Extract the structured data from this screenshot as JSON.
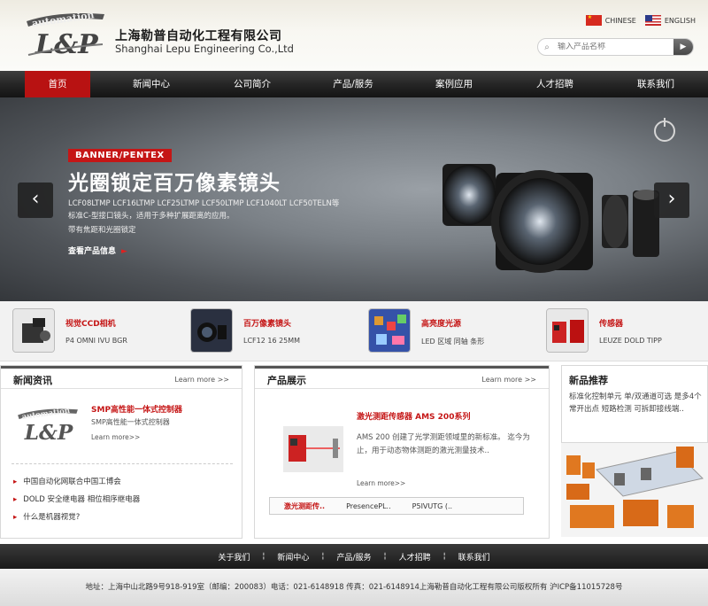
{
  "header": {
    "logo_text": "automation L&P",
    "company_cn": "上海勒普自动化工程有限公司",
    "company_en": "Shanghai Lepu Engineering Co.,Ltd",
    "lang": {
      "chinese": "CHINESE",
      "english": "ENGLISH"
    },
    "search": {
      "placeholder": "输入产品名称"
    }
  },
  "nav": {
    "items": [
      "首页",
      "新闻中心",
      "公司简介",
      "产品/服务",
      "案例应用",
      "人才招聘",
      "联系我们"
    ],
    "active_color": "#b81212"
  },
  "banner": {
    "brand": "BANNER/PENTEX",
    "title": "光圈锁定百万像素镜头",
    "models": "LCF08LTMP LCF16LTMP LCF25LTMP LCF50LTMP LCF1040LT LCF50TELN等",
    "desc1": "标准C-型接口镜头，适用于多种扩展距离的应用。",
    "desc2": "带有焦距和光圈锁定",
    "more": "查看产品信息"
  },
  "product_strip": [
    {
      "title": "视觉CCD相机",
      "desc": "P4 OMNI IVU BGR"
    },
    {
      "title": "百万像素镜头",
      "desc": "LCF12 16 25MM"
    },
    {
      "title": "高亮度光源",
      "desc": "LED 区域 同轴 条形"
    },
    {
      "title": "传感器",
      "desc": "LEUZE DOLD TIPP"
    }
  ],
  "news": {
    "title": "新闻资讯",
    "more": "Learn more >>",
    "featured_title": "SMP高性能一体式控制器",
    "featured_desc": "SMP高性能一体式控制器",
    "featured_more": "Learn more>>",
    "items": [
      "中国自动化网联合中国工博会",
      "DOLD 安全继电器 相位相序继电器",
      "什么是机器视觉?"
    ]
  },
  "products": {
    "title": "产品展示",
    "more": "Learn more >>",
    "featured_title": "激光测距传感器 AMS 200系列",
    "featured_desc": "AMS 200 创建了光学测距领域里的新标准。 迄今为止，用于动态物体测距的激光测量技术..",
    "featured_more": "Learn more>>",
    "marquee": [
      "激光测距传..",
      "PresencePL..",
      "P5IVUTG (.."
    ]
  },
  "recommend": {
    "title": "新品推荐",
    "desc": "标准化控制单元 单/双通道可选 是多4个常开出点 短路检测 可拆卸接线端.."
  },
  "footer": {
    "nav": [
      "关于我们",
      "新闻中心",
      "产品/服务",
      "人才招聘",
      "联系我们"
    ],
    "copyright": "地址：上海中山北路9号918-919室（邮编：200083）电话：021-6148918 传真：021-6148914上海勒普自动化工程有限公司版权所有 沪ICP备11015728号"
  },
  "colors": {
    "brand_red": "#c51616",
    "nav_dark": "#1e1e1e"
  }
}
